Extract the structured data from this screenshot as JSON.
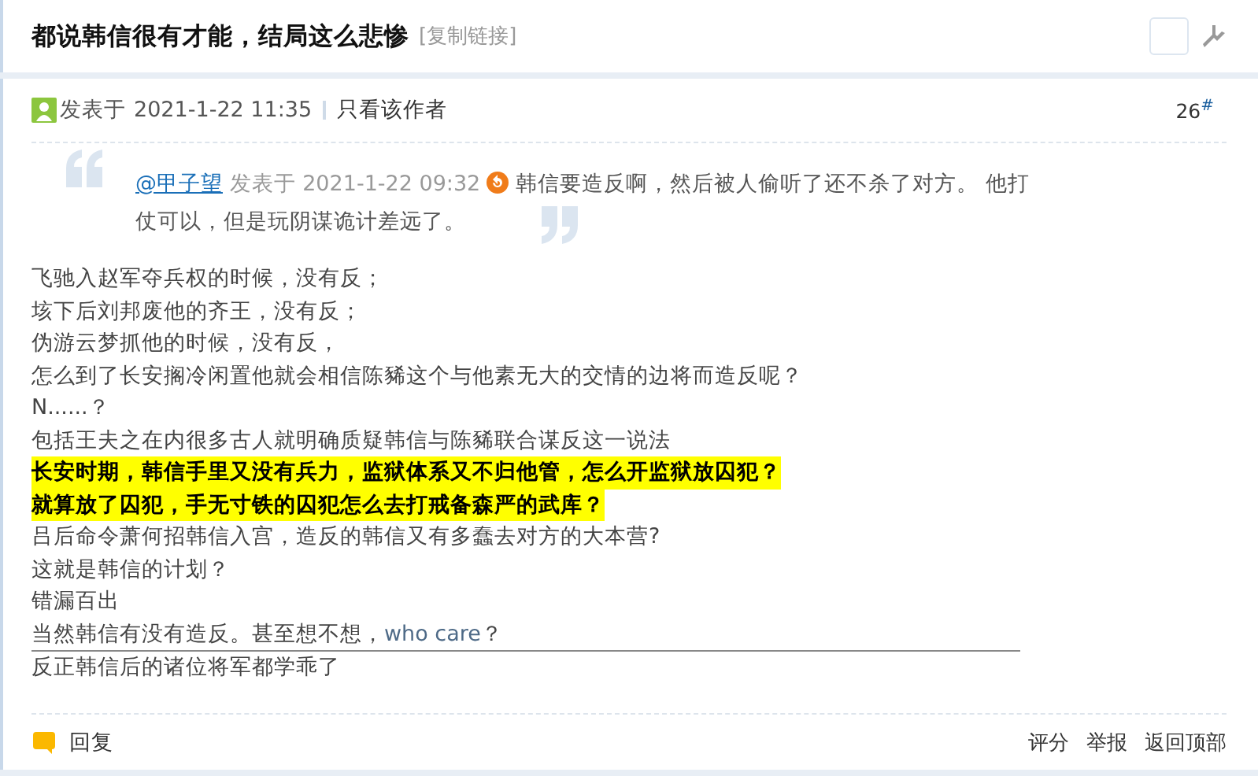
{
  "header": {
    "title": "都说韩信很有才能，结局这么悲惨",
    "copy_link": "[复制链接]",
    "checkbox_checked": false
  },
  "post": {
    "posted_label": "发表于",
    "posted_time": "2021-1-22 11:35",
    "author_only": "只看该作者",
    "floor": "26",
    "floor_mark": "#",
    "quote": {
      "user": "@甲子望",
      "posted_label": "发表于",
      "posted_time": "2021-1-22 09:32",
      "text": "韩信要造反啊，然后被人偷听了还不杀了对方。 他打仗可以，但是玩阴谋诡计差远了。"
    },
    "lines": [
      {
        "kind": "plain",
        "parts": [
          {
            "text": "飞驰入赵军夺兵权的时候，没有反；",
            "accent": false
          }
        ],
        "rule_below": false
      },
      {
        "kind": "plain",
        "parts": [
          {
            "text": "垓下后刘邦废他的齐王，没有反；",
            "accent": false
          }
        ],
        "rule_below": false
      },
      {
        "kind": "plain",
        "parts": [
          {
            "text": "伪游云梦抓他的时候，没有反，",
            "accent": false
          }
        ],
        "rule_below": false
      },
      {
        "kind": "plain",
        "parts": [
          {
            "text": "怎么到了长安搁冷闲置他就会相信陈豨这个与他素无大的交情的边将而造反呢？",
            "accent": false
          }
        ],
        "rule_below": false
      },
      {
        "kind": "plain",
        "parts": [
          {
            "text": "N......？",
            "accent": false
          }
        ],
        "rule_below": false
      },
      {
        "kind": "plain",
        "parts": [
          {
            "text": "包括王夫之在内很多古人就明确质疑韩信与陈豨联合谋反这一说法",
            "accent": false
          }
        ],
        "rule_below": false
      },
      {
        "kind": "highlight",
        "parts": [
          {
            "text": "长安时期，韩信手里又没有兵力，监狱体系又不归他管，怎么开监狱放囚犯？",
            "accent": false
          }
        ],
        "rule_below": false
      },
      {
        "kind": "highlight",
        "parts": [
          {
            "text": "就算放了囚犯，手无寸铁的囚犯怎么去打戒备森严的武库？",
            "accent": false
          }
        ],
        "rule_below": false
      },
      {
        "kind": "plain",
        "parts": [
          {
            "text": "吕后命令萧何招韩信入宫，造反的韩信又有多蠢去对方的大本营?",
            "accent": false
          }
        ],
        "rule_below": false
      },
      {
        "kind": "plain",
        "parts": [
          {
            "text": "这就是韩信的计划？",
            "accent": false
          }
        ],
        "rule_below": false
      },
      {
        "kind": "plain",
        "parts": [
          {
            "text": "错漏百出",
            "accent": false
          }
        ],
        "rule_below": false
      },
      {
        "kind": "plain",
        "parts": [
          {
            "text": "当然韩信有没有造反。甚至想不想，",
            "accent": false
          },
          {
            "text": "who care",
            "accent": true
          },
          {
            "text": "？",
            "accent": false
          }
        ],
        "rule_below": true
      },
      {
        "kind": "plain",
        "parts": [
          {
            "text": "反正韩信后的诸位将军都学乖了",
            "accent": false
          }
        ],
        "rule_below": false
      }
    ]
  },
  "footer": {
    "reply": "回复",
    "actions": [
      "评分",
      "举报",
      "返回顶部"
    ]
  }
}
